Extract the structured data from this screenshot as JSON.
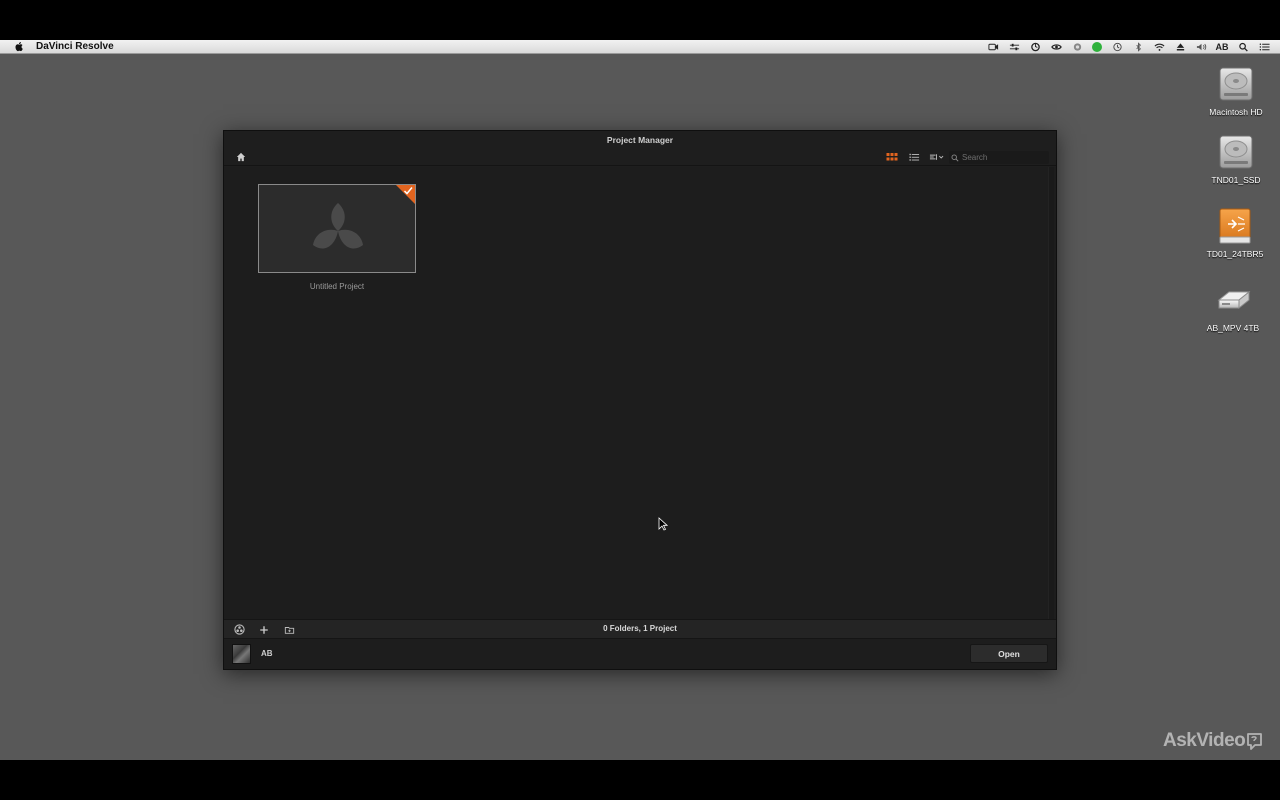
{
  "menubar": {
    "app_name": "DaVinci Resolve",
    "user_initials": "AB",
    "status_icons": [
      "camera-icon",
      "sliders-icon",
      "sync-icon",
      "nvidia-icon",
      "eye-icon",
      "green-status-icon",
      "time-machine-icon",
      "bluetooth-icon",
      "wifi-icon",
      "eject-icon",
      "volume-icon",
      "spotlight-search-icon",
      "notification-list-icon"
    ]
  },
  "desktop": {
    "drives": [
      {
        "label": "Macintosh HD",
        "icon": "hard-drive-icon"
      },
      {
        "label": "TND01_SSD",
        "icon": "hard-drive-icon"
      },
      {
        "label": "TD01_24TBR5",
        "icon": "external-drive-icon"
      },
      {
        "label": "AB_MPV 4TB",
        "icon": "removable-drive-icon"
      }
    ]
  },
  "window": {
    "title": "Project Manager",
    "search_placeholder": "Search",
    "accent_color": "#e1641f",
    "projects": [
      {
        "name": "Untitled Project"
      }
    ],
    "status": "0 Folders, 1 Project",
    "user": "AB",
    "open_label": "Open"
  },
  "watermark": {
    "text": "AskVideo"
  }
}
